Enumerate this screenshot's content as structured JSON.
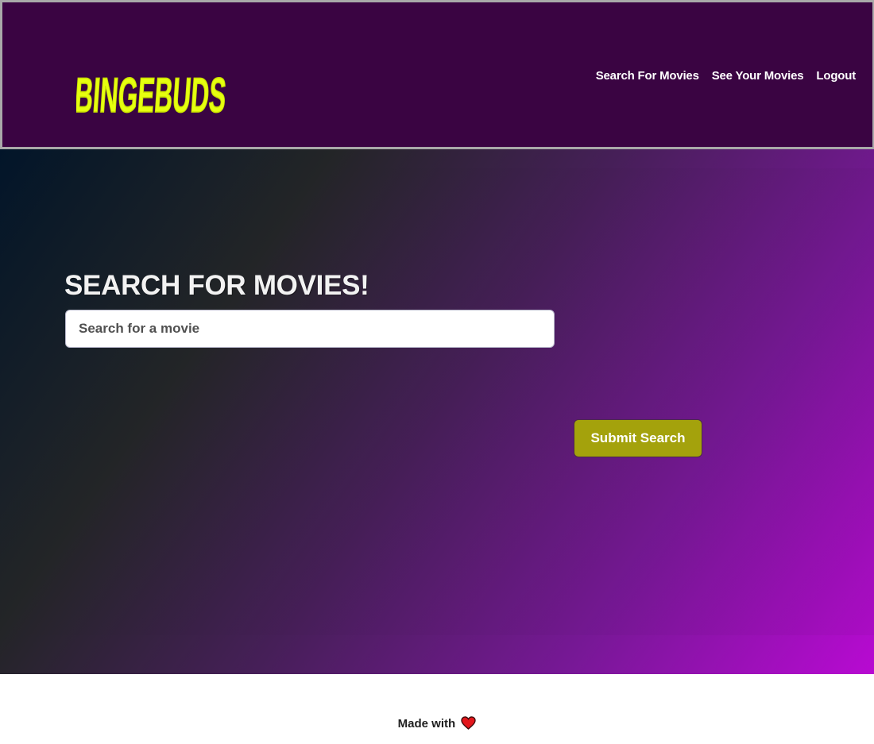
{
  "header": {
    "logo_text": "BINGEBUDS",
    "logo_color": "#e6ff0f",
    "background_color": "#3a0442",
    "nav": [
      {
        "label": "Search For Movies"
      },
      {
        "label": "See Your Movies"
      },
      {
        "label": "Logout"
      }
    ]
  },
  "main": {
    "title": "SEARCH FOR MOVIES!",
    "search": {
      "placeholder": "Search for a movie",
      "value": ""
    },
    "submit_label": "Submit Search",
    "submit_color": "#a4a20c"
  },
  "footer": {
    "text": "Made with",
    "icon": "heart-icon",
    "icon_color": "#e2171c"
  }
}
